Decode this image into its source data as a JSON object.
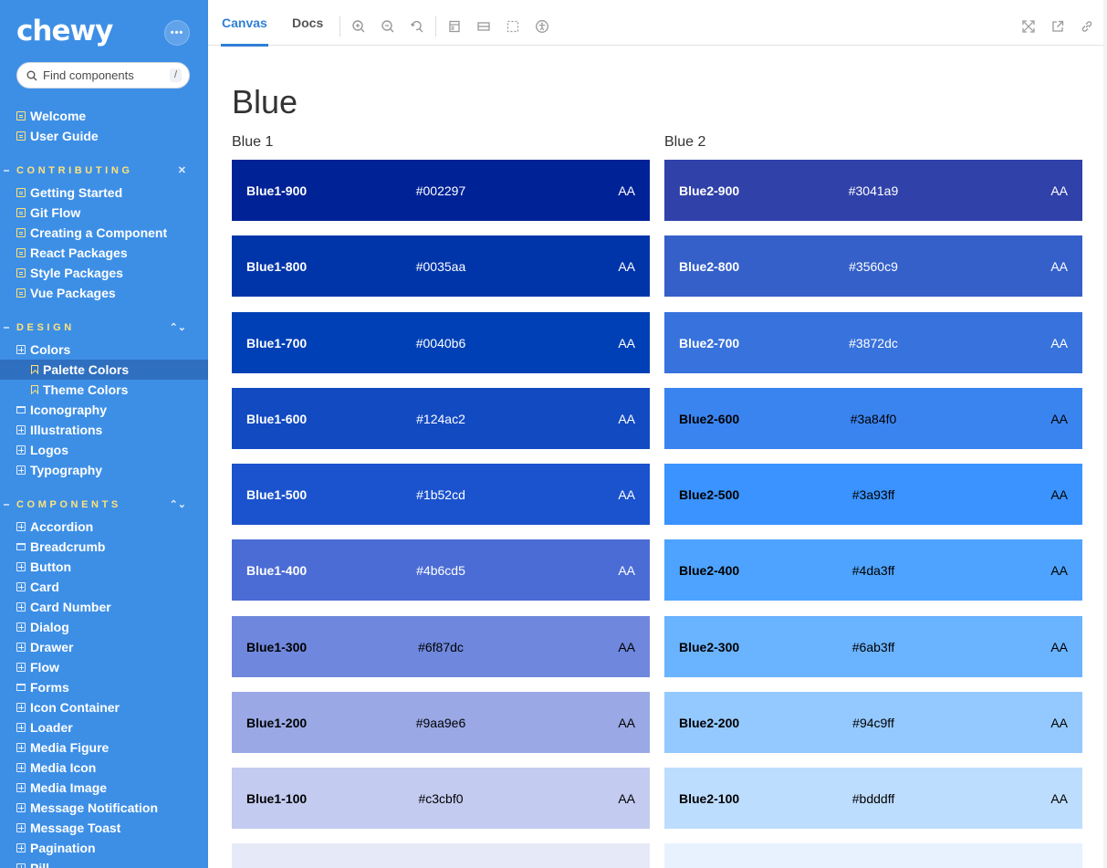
{
  "sidebar": {
    "logo": "chewy",
    "more_label": "•••",
    "search": {
      "placeholder": "Find components",
      "shortcut": "/"
    },
    "top_items": [
      {
        "label": "Welcome",
        "icon": "document-icon"
      },
      {
        "label": "User Guide",
        "icon": "document-icon"
      }
    ],
    "sections": [
      {
        "title": "CONTRIBUTING",
        "toggle": "✕",
        "items": [
          {
            "label": "Getting Started",
            "icon": "document-icon"
          },
          {
            "label": "Git Flow",
            "icon": "document-icon"
          },
          {
            "label": "Creating a Component",
            "icon": "document-icon"
          },
          {
            "label": "React Packages",
            "icon": "document-icon"
          },
          {
            "label": "Style Packages",
            "icon": "document-icon"
          },
          {
            "label": "Vue Packages",
            "icon": "document-icon"
          }
        ]
      },
      {
        "title": "DESIGN",
        "toggle": "⌃⌄",
        "items": [
          {
            "label": "Colors",
            "icon": "component-icon"
          },
          {
            "label": "Palette Colors",
            "icon": "bookmark-icon",
            "active": true
          },
          {
            "label": "Theme Colors",
            "icon": "bookmark-icon"
          },
          {
            "label": "Iconography",
            "icon": "folder-icon"
          },
          {
            "label": "Illustrations",
            "icon": "component-icon"
          },
          {
            "label": "Logos",
            "icon": "component-icon"
          },
          {
            "label": "Typography",
            "icon": "component-icon"
          }
        ]
      },
      {
        "title": "COMPONENTS",
        "toggle": "⌃⌄",
        "items": [
          {
            "label": "Accordion",
            "icon": "component-icon"
          },
          {
            "label": "Breadcrumb",
            "icon": "folder-icon"
          },
          {
            "label": "Button",
            "icon": "component-icon"
          },
          {
            "label": "Card",
            "icon": "component-icon"
          },
          {
            "label": "Card Number",
            "icon": "component-icon"
          },
          {
            "label": "Dialog",
            "icon": "component-icon"
          },
          {
            "label": "Drawer",
            "icon": "component-icon"
          },
          {
            "label": "Flow",
            "icon": "component-icon"
          },
          {
            "label": "Forms",
            "icon": "folder-icon"
          },
          {
            "label": "Icon Container",
            "icon": "component-icon"
          },
          {
            "label": "Loader",
            "icon": "component-icon"
          },
          {
            "label": "Media Figure",
            "icon": "component-icon"
          },
          {
            "label": "Media Icon",
            "icon": "component-icon"
          },
          {
            "label": "Media Image",
            "icon": "component-icon"
          },
          {
            "label": "Message Notification",
            "icon": "component-icon"
          },
          {
            "label": "Message Toast",
            "icon": "component-icon"
          },
          {
            "label": "Pagination",
            "icon": "component-icon"
          },
          {
            "label": "Pill",
            "icon": "component-icon"
          }
        ]
      }
    ]
  },
  "toolbar": {
    "tabs": [
      {
        "label": "Canvas",
        "active": true
      },
      {
        "label": "Docs",
        "active": false
      }
    ],
    "tools": [
      "zoom-in-icon",
      "zoom-out-icon",
      "zoom-reset-icon",
      "background-icon",
      "grid-icon",
      "outline-icon",
      "accessibility-icon"
    ],
    "right_tools": [
      "fullscreen-icon",
      "open-new-tab-icon",
      "copy-link-icon"
    ]
  },
  "main": {
    "title": "Blue",
    "columns": [
      {
        "title": "Blue 1",
        "swatches": [
          {
            "name": "Blue1-900",
            "hex": "#002297",
            "rating": "AA",
            "text": "#ffffff"
          },
          {
            "name": "Blue1-800",
            "hex": "#0035aa",
            "rating": "AA",
            "text": "#ffffff"
          },
          {
            "name": "Blue1-700",
            "hex": "#0040b6",
            "rating": "AA",
            "text": "#ffffff"
          },
          {
            "name": "Blue1-600",
            "hex": "#124ac2",
            "rating": "AA",
            "text": "#ffffff"
          },
          {
            "name": "Blue1-500",
            "hex": "#1b52cd",
            "rating": "AA",
            "text": "#ffffff"
          },
          {
            "name": "Blue1-400",
            "hex": "#4b6cd5",
            "rating": "AA",
            "text": "#ffffff"
          },
          {
            "name": "Blue1-300",
            "hex": "#6f87dc",
            "rating": "AA",
            "text": "#000000"
          },
          {
            "name": "Blue1-200",
            "hex": "#9aa9e6",
            "rating": "AA",
            "text": "#000000"
          },
          {
            "name": "Blue1-100",
            "hex": "#c3cbf0",
            "rating": "AA",
            "text": "#000000"
          },
          {
            "name": "",
            "hex": "",
            "rating": "",
            "text": "#000000",
            "fill": "#e6e9f8"
          }
        ]
      },
      {
        "title": "Blue 2",
        "swatches": [
          {
            "name": "Blue2-900",
            "hex": "#3041a9",
            "rating": "AA",
            "text": "#ffffff"
          },
          {
            "name": "Blue2-800",
            "hex": "#3560c9",
            "rating": "AA",
            "text": "#ffffff"
          },
          {
            "name": "Blue2-700",
            "hex": "#3872dc",
            "rating": "AA",
            "text": "#ffffff"
          },
          {
            "name": "Blue2-600",
            "hex": "#3a84f0",
            "rating": "AA",
            "text": "#000000"
          },
          {
            "name": "Blue2-500",
            "hex": "#3a93ff",
            "rating": "AA",
            "text": "#000000"
          },
          {
            "name": "Blue2-400",
            "hex": "#4da3ff",
            "rating": "AA",
            "text": "#000000"
          },
          {
            "name": "Blue2-300",
            "hex": "#6ab3ff",
            "rating": "AA",
            "text": "#000000"
          },
          {
            "name": "Blue2-200",
            "hex": "#94c9ff",
            "rating": "AA",
            "text": "#000000"
          },
          {
            "name": "Blue2-100",
            "hex": "#bdddff",
            "rating": "AA",
            "text": "#000000"
          },
          {
            "name": "",
            "hex": "",
            "rating": "",
            "text": "#000000",
            "fill": "#e8f2ff"
          }
        ]
      }
    ]
  },
  "colors": {
    "sidebar_bg": "#3d8fe6",
    "sidebar_active": "#2f6fbf",
    "section_title": "#ffe27a",
    "tab_active": "#2f7fd6"
  }
}
